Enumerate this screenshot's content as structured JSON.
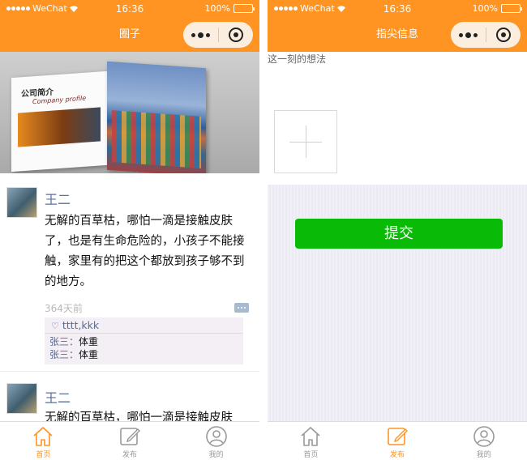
{
  "status_bar": {
    "carrier": "WeChat",
    "time": "16:36",
    "battery": "100%"
  },
  "left_screen": {
    "nav_title": "圈子",
    "banner": {
      "brochure_title": "公司简介",
      "brochure_subtitle": "Company profile",
      "dots_count": 3,
      "active_dot": 3
    },
    "posts": [
      {
        "author": "王二",
        "content": "无解的百草枯，哪怕一滴是接触皮肤了，也是有生命危险的，小孩子不能接触，家里有的把这个都放到孩子够不到的地方。",
        "time": "364天前",
        "likes": "tttt,kkk",
        "comments": [
          {
            "who": "张三：",
            "text": "体重"
          },
          {
            "who": "张三：",
            "text": "体重"
          }
        ]
      },
      {
        "author": "王二",
        "content": "无解的百草枯，哪怕一滴是接触皮肤"
      }
    ]
  },
  "right_screen": {
    "nav_title": "指尖信息",
    "textarea_placeholder": "这一刻的想法",
    "submit_label": "提交"
  },
  "tabbar": {
    "items": [
      {
        "label": "首页",
        "icon": "home-icon"
      },
      {
        "label": "发布",
        "icon": "edit-icon"
      },
      {
        "label": "我的",
        "icon": "user-icon"
      }
    ],
    "left_active": 0,
    "right_active": 1
  },
  "colors": {
    "brand": "#FF9422",
    "submit": "#09BB07",
    "link": "#576B95",
    "tab_inactive": "#999999"
  }
}
